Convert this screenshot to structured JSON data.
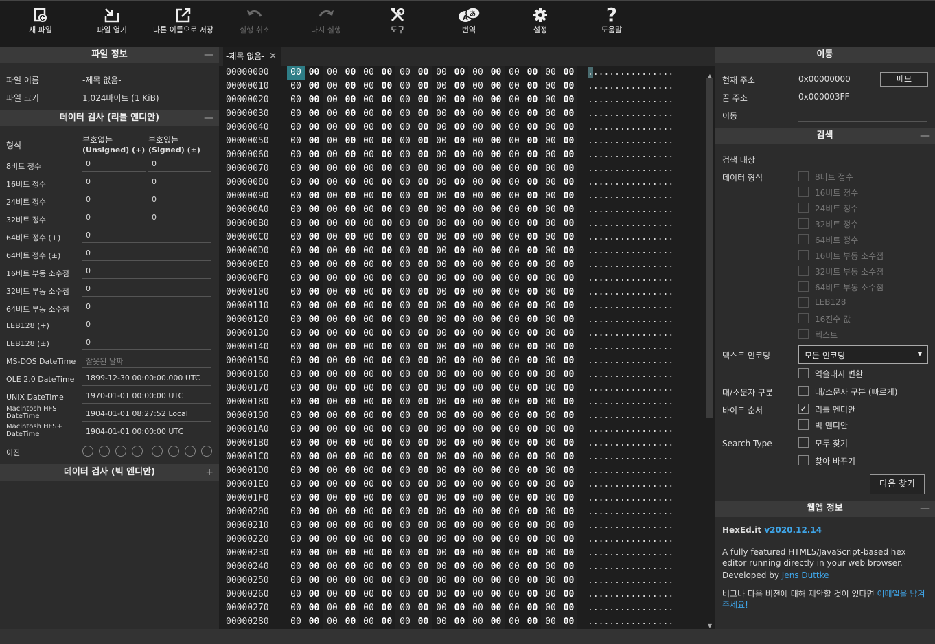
{
  "toolbar": {
    "new_file": "새 파일",
    "open_file": "파일 열기",
    "save_as": "다른 이름으로 저장",
    "undo": "실행 취소",
    "redo": "다시 실행",
    "tools": "도구",
    "translate": "번역",
    "settings": "설정",
    "help": "도움말"
  },
  "file_info": {
    "title": "파일 정보",
    "toggle": "—",
    "name_label": "파일 이름",
    "name_value": "-제목 없음-",
    "size_label": "파일 크기",
    "size_value": "1,024바이트 (1 KiB)"
  },
  "inspector_le": {
    "title": "데이터 검사 (리틀 엔디안)",
    "toggle": "—",
    "format_label": "형식",
    "unsigned_header": "부호없는",
    "unsigned_sub": "(Unsigned) (+)",
    "signed_header": "부호있는",
    "signed_sub": "(Signed) (±)",
    "rows": [
      {
        "label": "8비트 정수",
        "unsigned": "0",
        "signed": "0"
      },
      {
        "label": "16비트 정수",
        "unsigned": "0",
        "signed": "0"
      },
      {
        "label": "24비트 정수",
        "unsigned": "0",
        "signed": "0"
      },
      {
        "label": "32비트 정수",
        "unsigned": "0",
        "signed": "0"
      }
    ],
    "wide_rows": [
      {
        "label": "64비트 정수 (+)",
        "value": "0"
      },
      {
        "label": "64비트 정수 (±)",
        "value": "0"
      },
      {
        "label": "16비트 부동 소수점",
        "value": "0"
      },
      {
        "label": "32비트 부동 소수점",
        "value": "0"
      },
      {
        "label": "64비트 부동 소수점",
        "value": "0"
      },
      {
        "label": "LEB128 (+)",
        "value": "0"
      },
      {
        "label": "LEB128 (±)",
        "value": "0"
      },
      {
        "label": "MS-DOS DateTime",
        "value": "잘못된 날짜"
      },
      {
        "label": "OLE 2.0 DateTime",
        "value": "1899-12-30 00:00:00.000 UTC"
      },
      {
        "label": "UNIX DateTime",
        "value": "1970-01-01 00:00:00 UTC"
      },
      {
        "label": "Macintosh HFS DateTime",
        "value": "1904-01-01 08:27:52 Local"
      },
      {
        "label": "Macintosh HFS+ DateTime",
        "value": "1904-01-01 00:00:00 UTC"
      }
    ],
    "binary_label": "이진"
  },
  "inspector_be": {
    "title": "데이터 검사 (빅 엔디안)",
    "toggle": "+"
  },
  "hex": {
    "tab_title": "-제목 없음-",
    "tab_close": "×",
    "byte_value": "00",
    "ascii_line": "................",
    "start_address": 0,
    "rows_visible": 41,
    "cursor_offset": 0
  },
  "goto": {
    "title": "이동",
    "toggle": "",
    "current_label": "현재 주소",
    "current_value": "0x00000000",
    "memo_button": "메모",
    "end_label": "끝 주소",
    "end_value": "0x000003FF",
    "goto_label": "이동"
  },
  "search": {
    "title": "검색",
    "toggle": "—",
    "target_label": "검색 대상",
    "datatype_label": "데이터 형식",
    "datatypes": [
      "8비트 정수",
      "16비트 정수",
      "24비트 정수",
      "32비트 정수",
      "64비트 정수",
      "16비트 부동 소수점",
      "32비트 부동 소수점",
      "64비트 부동 소수점",
      "LEB128",
      "16진수 값",
      "텍스트"
    ],
    "encoding_label": "텍스트 인코딩",
    "encoding_value": "모든 인코딩",
    "backslash_label": "역슬래시 변환",
    "case_label": "대/소문자 구분",
    "case_option": "대/소문자 구분 (빠르게)",
    "byteorder_label": "바이트 순서",
    "little_endian": "리틀 엔디안",
    "big_endian": "빅 엔디안",
    "search_type_label": "Search Type",
    "find_all": "모두 찾기",
    "replace": "찾아 바꾸기",
    "find_next": "다음 찾기"
  },
  "webapp": {
    "title": "웹앱 정보",
    "toggle": "—",
    "app_name": "HexEd.it",
    "version": "v2020.12.14",
    "description": "A fully featured HTML5/JavaScript-based hex editor running directly in your web browser.",
    "developed_by": "Developed by",
    "author": "Jens Duttke",
    "feedback_pre": "버그나 다음 버전에 대해 제안할 것이 있다면",
    "feedback_link": "이메일을 남겨 주세요!"
  }
}
